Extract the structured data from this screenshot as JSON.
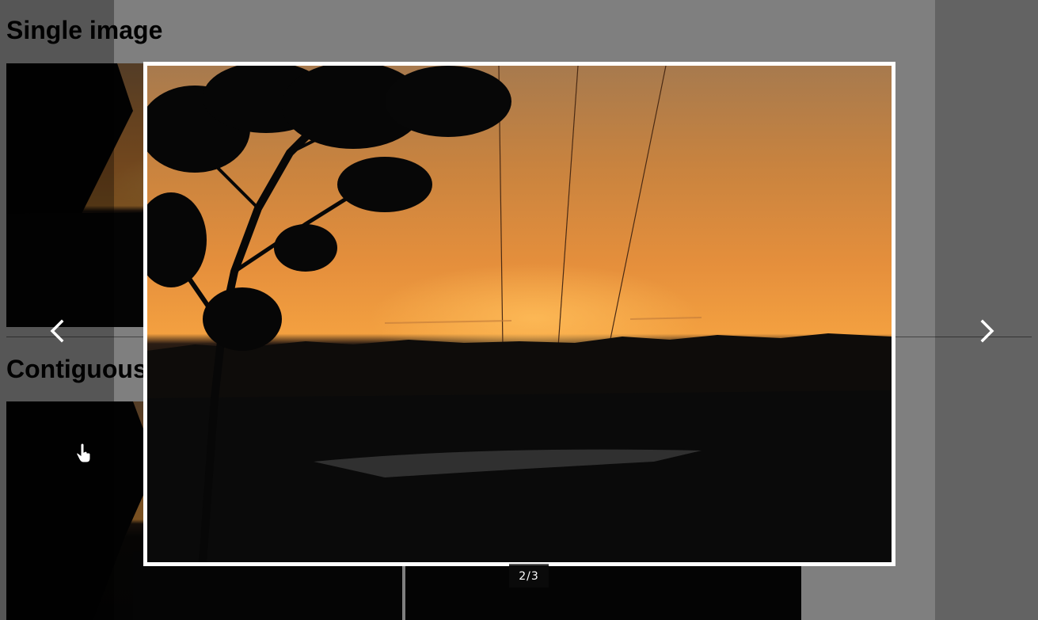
{
  "page": {
    "heading_single": "Single image",
    "heading_contiguous": "Contiguous"
  },
  "lightbox": {
    "counter": "2/3",
    "prev_icon": "chevron-left-icon",
    "next_icon": "chevron-right-icon"
  },
  "colors": {
    "overlay": "#000000",
    "frame": "#ffffff",
    "sky_top": "#a77a4e",
    "sky_horizon": "#f3a040"
  }
}
